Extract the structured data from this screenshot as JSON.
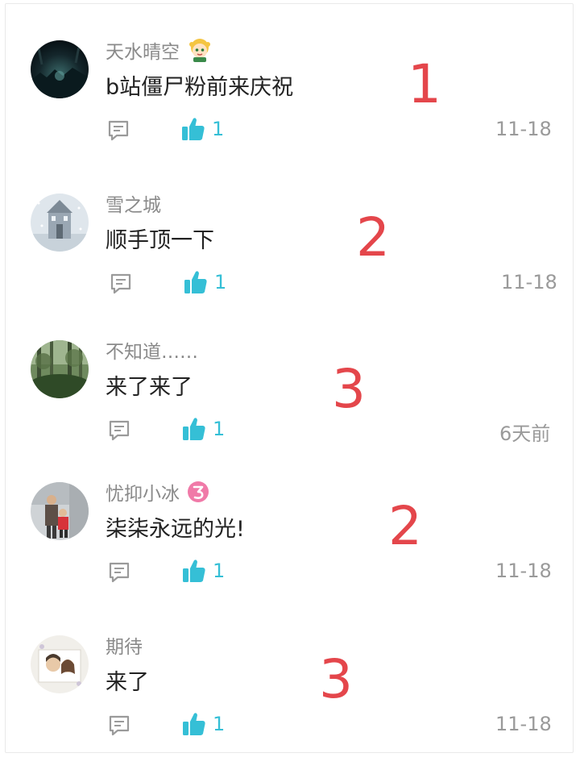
{
  "comments": [
    {
      "username": "天水晴空",
      "badge": "cartoon-character-badge",
      "text": "b站僵尸粉前来庆祝",
      "annotation": "1",
      "likes": "1",
      "time": "11-18",
      "avatar": "dark-night-scene-avatar"
    },
    {
      "username": "雪之城",
      "badge": "",
      "text": "顺手顶一下",
      "annotation": "2",
      "likes": "1",
      "time": "11-18",
      "avatar": "snow-castle-avatar"
    },
    {
      "username": "不知道……",
      "badge": "",
      "text": "来了来了",
      "annotation": "3",
      "likes": "1",
      "time": "6天前",
      "avatar": "forest-avatar"
    },
    {
      "username": "忧抑小冰",
      "badge": "pink-level-badge",
      "text": "柒柒永远的光!",
      "annotation": "2",
      "likes": "1",
      "time": "11-18",
      "avatar": "family-photo-avatar"
    },
    {
      "username": "期待",
      "badge": "",
      "text": "来了",
      "annotation": "3",
      "likes": "1",
      "time": "11-18",
      "avatar": "illustrated-couple-avatar"
    }
  ],
  "colors": {
    "like_accent": "#35bfd6",
    "annotation_red": "#e4464b",
    "username_gray": "#8a8a8a",
    "text_dark": "#222222"
  }
}
